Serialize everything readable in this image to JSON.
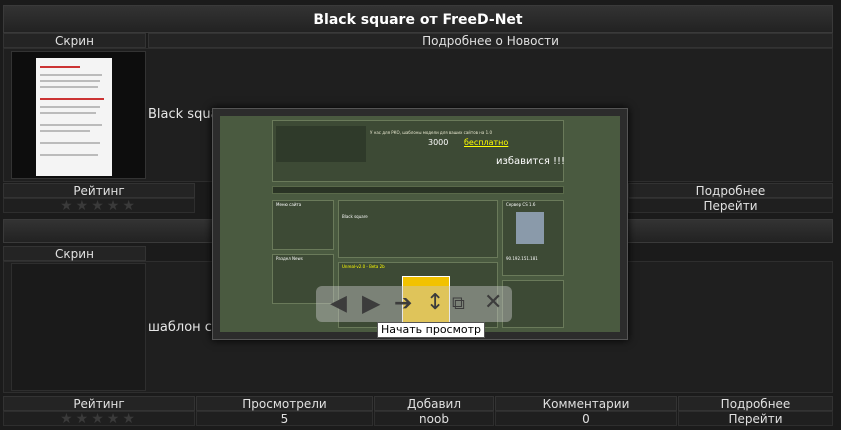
{
  "page_title": "Black square от FreeD-Net",
  "news1": {
    "col_screen": "Скрин",
    "col_more": "Подробнее о Новости",
    "text": "Black square",
    "rating_label": "Рейтинг",
    "details_label": "Подробнее",
    "go_label": "Перейти"
  },
  "news2": {
    "col_screen": "Скрин",
    "text": "шаблон cs",
    "footer": {
      "rating": "Рейтинг",
      "views": "Просмотрели",
      "added": "Добавил",
      "comments": "Комментарии",
      "details": "Подробнее"
    },
    "values": {
      "views": "5",
      "added": "noob",
      "comments": "0",
      "go": "Перейти"
    }
  },
  "viewer": {
    "tooltip": "Начать просмотр",
    "buttons": [
      "prev",
      "play",
      "next",
      "fullsize",
      "close"
    ],
    "shot_text": {
      "promo_line": "У нас для РКО, шаблоны модели для ваших сайтов на 1.0",
      "promo_count": "3000",
      "promo_free": "бесплатно",
      "promo_tail": "избавится !!!",
      "block1": "Меню сайта",
      "block2": "Раздел News",
      "news_title": "Black square",
      "news_title2": "Unreal-v2.0 - Beta 2b",
      "server": "Сервер CS 1.6",
      "server_ip": "90.192.151.181"
    }
  },
  "rating_stars": 0,
  "colors": {
    "star": "#3a3a3a",
    "bg": "#1b1b1b"
  }
}
